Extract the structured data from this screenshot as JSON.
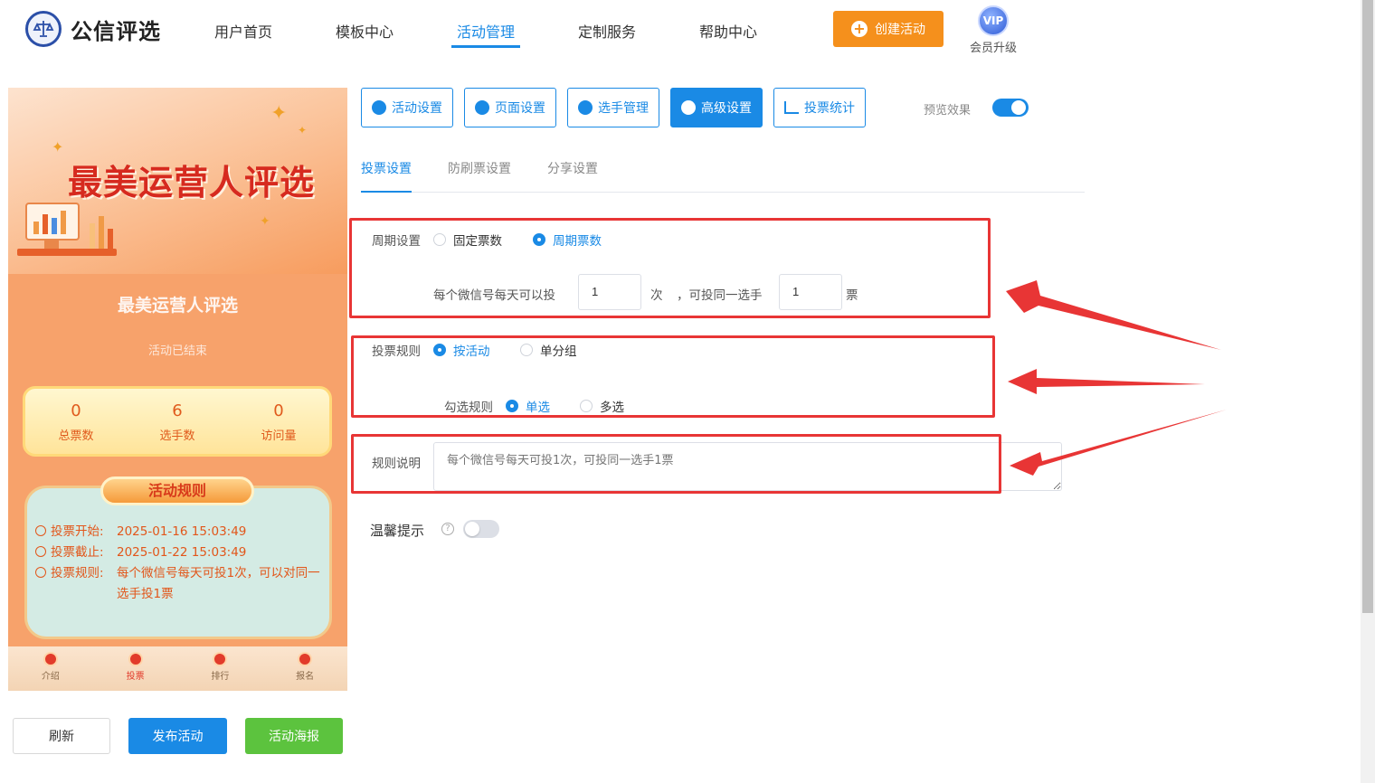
{
  "header": {
    "logo_text": "公信评选",
    "nav": [
      "用户首页",
      "模板中心",
      "活动管理",
      "定制服务",
      "帮助中心"
    ],
    "nav_active": "活动管理",
    "create_button": "创建活动",
    "vip_badge": "VIP",
    "vip_label": "会员升级"
  },
  "preview": {
    "banner_title": "最美运营人评选",
    "title": "最美运营人评选",
    "status": "活动已结束",
    "stats": [
      {
        "value": "0",
        "label": "总票数"
      },
      {
        "value": "6",
        "label": "选手数"
      },
      {
        "value": "0",
        "label": "访问量"
      }
    ],
    "rules_heading": "活动规则",
    "rules": [
      {
        "label": "投票开始:",
        "value": "2025-01-16 15:03:49"
      },
      {
        "label": "投票截止:",
        "value": "2025-01-22 15:03:49"
      },
      {
        "label": "投票规则:",
        "value": "每个微信号每天可投1次，可以对同一选手投1票"
      }
    ],
    "tabs": [
      "介绍",
      "投票",
      "排行",
      "报名"
    ],
    "active_tab": "投票"
  },
  "actions": {
    "refresh": "刷新",
    "publish": "发布活动",
    "poster": "活动海报"
  },
  "toolbar": {
    "buttons": [
      "活动设置",
      "页面设置",
      "选手管理",
      "高级设置",
      "投票统计"
    ],
    "active": "高级设置",
    "preview_label": "预览效果",
    "preview_on": true
  },
  "subtabs": {
    "items": [
      "投票设置",
      "防刷票设置",
      "分享设置"
    ],
    "active": "投票设置"
  },
  "form": {
    "cycle_label": "周期设置",
    "cycle_options": [
      "固定票数",
      "周期票数"
    ],
    "cycle_selected": "周期票数",
    "daily_prefix": "每个微信号每天可以投",
    "daily_times": "1",
    "daily_times_unit": "次",
    "same_player_prefix": "，可投同一选手",
    "same_player_votes": "1",
    "same_player_unit": "票",
    "rule_label": "投票规则",
    "rule_options": [
      "按活动",
      "单分组"
    ],
    "rule_selected": "按活动",
    "check_label": "勾选规则",
    "check_options": [
      "单选",
      "多选"
    ],
    "check_selected": "单选",
    "desc_label": "规则说明",
    "desc_placeholder": "每个微信号每天可投1次，可投同一选手1票",
    "tip_label": "温馨提示",
    "tip_on": false
  },
  "colors": {
    "primary": "#1a8ae5",
    "orange": "#f5901c",
    "green": "#5cc33e",
    "highlight": "#e83535"
  }
}
